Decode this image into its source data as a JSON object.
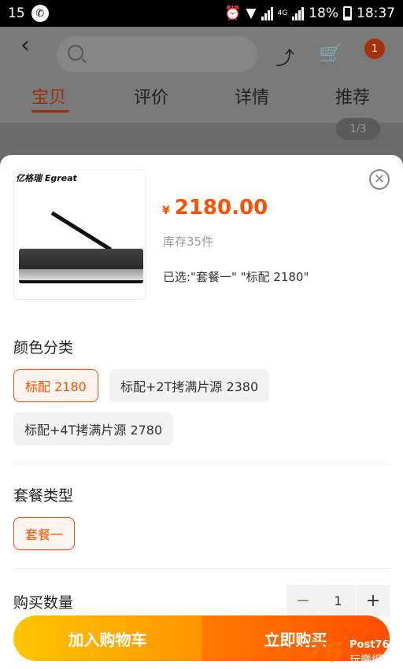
{
  "status_bar": {
    "notification_count": "15",
    "network_label": "4G",
    "battery": "18%",
    "time": "18:37"
  },
  "header": {
    "tabs": [
      {
        "label": "宝贝",
        "active": true
      },
      {
        "label": "评价",
        "active": false
      },
      {
        "label": "详情",
        "active": false
      },
      {
        "label": "推荐",
        "active": false
      }
    ],
    "cart_badge": "1",
    "image_counter": "1/3"
  },
  "sku_sheet": {
    "product_brand": "亿格瑞 Egreat",
    "price_symbol": "¥",
    "price": "2180.00",
    "stock": "库存35件",
    "selected_text": "已选:\"套餐一\" \"标配 2180\"",
    "color_section": {
      "title": "颜色分类",
      "options": [
        {
          "label": "标配 2180",
          "selected": true
        },
        {
          "label": "标配+2T拷满片源 2380",
          "selected": false
        },
        {
          "label": "标配+4T拷满片源 2780",
          "selected": false
        }
      ]
    },
    "package_section": {
      "title": "套餐类型",
      "options": [
        {
          "label": "套餐一",
          "selected": true
        }
      ]
    },
    "quantity": {
      "title": "购买数量",
      "minus": "−",
      "value": "1",
      "plus": "+"
    },
    "add_to_cart_label": "加入购物车",
    "buy_now_label": "立即购买"
  },
  "watermark": {
    "number": "76",
    "top": "Post76",
    "bottom": "玩樂網"
  },
  "colors": {
    "accent": "#ff5000",
    "cart_button_start": "#ffc500",
    "buy_button_end": "#ff4e00"
  }
}
